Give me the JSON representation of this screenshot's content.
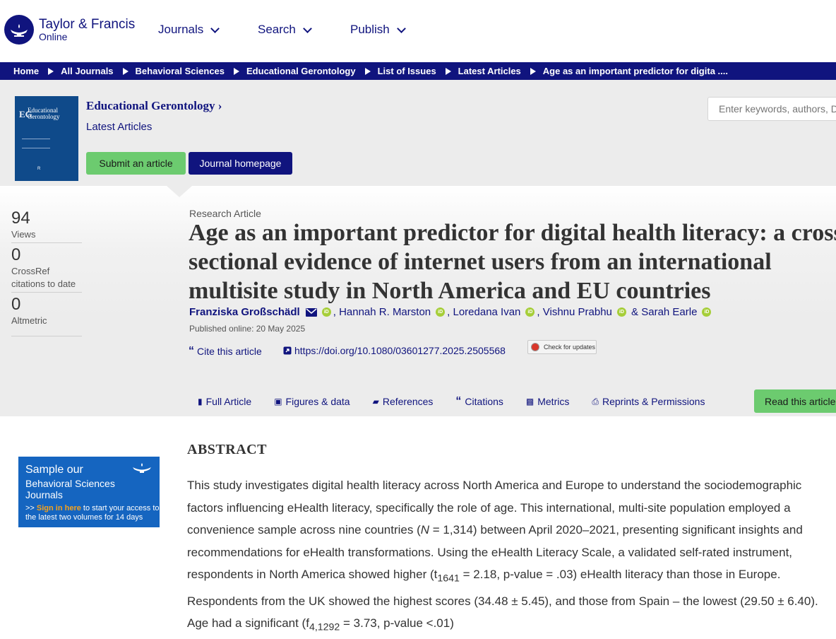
{
  "header": {
    "logo_line1": "Taylor & Francis",
    "logo_line2": "Online",
    "nav": [
      "Journals",
      "Search",
      "Publish"
    ]
  },
  "breadcrumb": [
    "Home",
    "All Journals",
    "Behavioral Sciences",
    "Educational Gerontology",
    "List of Issues",
    "Latest Articles",
    "Age as an important predictor for digita ...."
  ],
  "journal": {
    "cover_title": "Educational Gerontology",
    "cover_initials": "EG",
    "title": "Educational Gerontology ›",
    "latest": "Latest Articles",
    "submit_label": "Submit an article",
    "homepage_label": "Journal homepage",
    "search_placeholder": "Enter keywords, authors, DOI, ORCID etc"
  },
  "metrics": [
    {
      "value": "94",
      "label": "Views"
    },
    {
      "value": "0",
      "label": "CrossRef citations to date"
    },
    {
      "value": "0",
      "label": "Altmetric"
    }
  ],
  "article": {
    "type": "Research Article",
    "title_lines": [
      "Age as an important predictor for digital health literacy: a cross-",
      "sectional evidence of internet users from an international",
      "multisite study in North America and EU countries"
    ],
    "authors": [
      "Franziska Großschädl",
      "Hannah R. Marston",
      "Loredana Ivan",
      "Vishnu Prabhu",
      "Sarah Earle"
    ],
    "published": "Published online: 20 May 2025",
    "cite_label": "Cite this article",
    "doi": "https://doi.org/10.1080/03601277.2025.2505568",
    "updates_label": "Check for updates"
  },
  "tabs": [
    "Full Article",
    "Figures & data",
    "References",
    "Citations",
    "Metrics",
    "Reprints & Permissions"
  ],
  "read_button": "Read this article",
  "ad": {
    "line1": "Sample our",
    "line2": "Behavioral Sciences Journals",
    "prefix": ">> ",
    "sign_in": "Sign in here",
    "line3": " to start your access to the latest two volumes for 14 days"
  },
  "abstract": {
    "heading": "ABSTRACT",
    "text_parts": [
      "This study investigates digital health literacy across North America and Europe to understand the sociodemographic factors influencing eHealth literacy, specifically the role of age. This international, multi-site population employed a convenience sample across nine countries (",
      "N",
      " = 1,314) between April 2020–2021, presenting significant insights and recommendations for eHealth transformations. Using the eHealth Literacy Scale, a validated self-rated instrument, respondents in North America showed higher (t",
      "1641",
      " = 2.18, p-value = .03) eHealth literacy than those in Europe. Respondents from the UK showed the highest scores (34.48 ± 5.45), and those from Spain – the lowest (29.50 ± 6.40). Age had a significant (f",
      "4,1292",
      " = 3.73, p-value <.01)"
    ]
  },
  "colors": {
    "navy": "#10147e",
    "green": "#6ccb6f",
    "orcid": "#a6ce39",
    "ad_blue": "#1565c0"
  }
}
